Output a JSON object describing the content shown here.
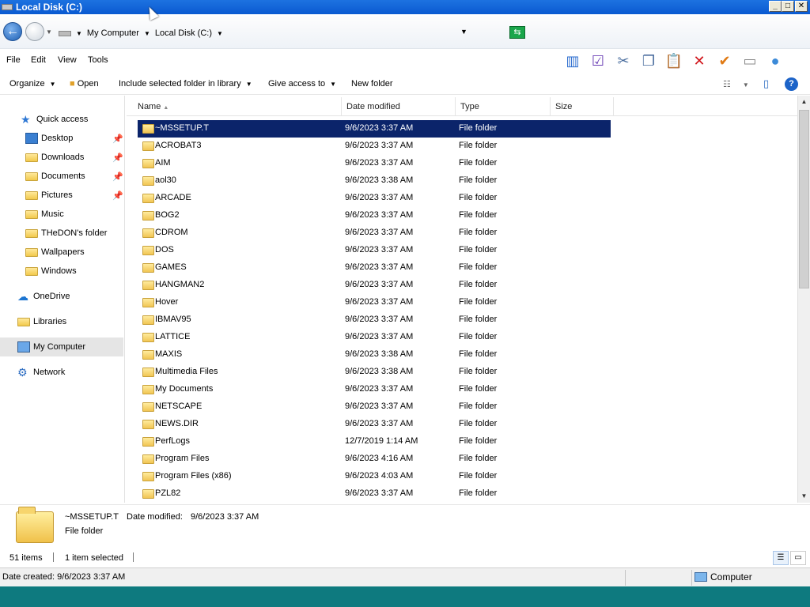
{
  "window": {
    "title": "Local Disk (C:)"
  },
  "address": {
    "crumbs": [
      "My Computer",
      "Local Disk (C:)"
    ]
  },
  "menu": {
    "items": [
      "File",
      "Edit",
      "View",
      "Tools"
    ]
  },
  "commands": {
    "organize": "Organize",
    "open": "Open",
    "include": "Include selected folder in library",
    "share": "Give access to",
    "new_folder": "New folder",
    "help": "?"
  },
  "nav": {
    "quick_access": "Quick access",
    "items": [
      {
        "label": "Desktop",
        "pinned": true
      },
      {
        "label": "Downloads",
        "pinned": true
      },
      {
        "label": "Documents",
        "pinned": true
      },
      {
        "label": "Pictures",
        "pinned": true
      },
      {
        "label": "Music",
        "pinned": false
      },
      {
        "label": "THeDON's folder",
        "pinned": false
      },
      {
        "label": "Wallpapers",
        "pinned": false
      },
      {
        "label": "Windows",
        "pinned": false
      }
    ],
    "onedrive": "OneDrive",
    "libraries": "Libraries",
    "my_computer": "My Computer",
    "network": "Network"
  },
  "columns": {
    "name": "Name",
    "date": "Date modified",
    "type": "Type",
    "size": "Size"
  },
  "files": [
    {
      "name": "~MSSETUP.T",
      "date": "9/6/2023 3:37 AM",
      "type": "File folder",
      "selected": true
    },
    {
      "name": "ACROBAT3",
      "date": "9/6/2023 3:37 AM",
      "type": "File folder"
    },
    {
      "name": "AIM",
      "date": "9/6/2023 3:37 AM",
      "type": "File folder"
    },
    {
      "name": "aol30",
      "date": "9/6/2023 3:38 AM",
      "type": "File folder"
    },
    {
      "name": "ARCADE",
      "date": "9/6/2023 3:37 AM",
      "type": "File folder"
    },
    {
      "name": "BOG2",
      "date": "9/6/2023 3:37 AM",
      "type": "File folder"
    },
    {
      "name": "CDROM",
      "date": "9/6/2023 3:37 AM",
      "type": "File folder"
    },
    {
      "name": "DOS",
      "date": "9/6/2023 3:37 AM",
      "type": "File folder"
    },
    {
      "name": "GAMES",
      "date": "9/6/2023 3:37 AM",
      "type": "File folder"
    },
    {
      "name": "HANGMAN2",
      "date": "9/6/2023 3:37 AM",
      "type": "File folder"
    },
    {
      "name": "Hover",
      "date": "9/6/2023 3:37 AM",
      "type": "File folder"
    },
    {
      "name": "IBMAV95",
      "date": "9/6/2023 3:37 AM",
      "type": "File folder"
    },
    {
      "name": "LATTICE",
      "date": "9/6/2023 3:37 AM",
      "type": "File folder"
    },
    {
      "name": "MAXIS",
      "date": "9/6/2023 3:38 AM",
      "type": "File folder"
    },
    {
      "name": "Multimedia Files",
      "date": "9/6/2023 3:38 AM",
      "type": "File folder"
    },
    {
      "name": "My Documents",
      "date": "9/6/2023 3:37 AM",
      "type": "File folder"
    },
    {
      "name": "NETSCAPE",
      "date": "9/6/2023 3:37 AM",
      "type": "File folder"
    },
    {
      "name": "NEWS.DIR",
      "date": "9/6/2023 3:37 AM",
      "type": "File folder"
    },
    {
      "name": "PerfLogs",
      "date": "12/7/2019 1:14 AM",
      "type": "File folder"
    },
    {
      "name": "Program Files",
      "date": "9/6/2023 4:16 AM",
      "type": "File folder"
    },
    {
      "name": "Program Files (x86)",
      "date": "9/6/2023 4:03 AM",
      "type": "File folder"
    },
    {
      "name": "PZL82",
      "date": "9/6/2023 3:37 AM",
      "type": "File folder"
    }
  ],
  "details": {
    "name": "~MSSETUP.T",
    "date_label": "Date modified:",
    "date_value": "9/6/2023 3:37 AM",
    "type": "File folder"
  },
  "counts": {
    "items": "51 items",
    "selected": "1 item selected"
  },
  "status": {
    "text": "Date created: 9/6/2023 3:37 AM",
    "zone": "Computer"
  },
  "colors": {
    "selection": "#0b246a",
    "titlebar": "#0a5ad1",
    "desktop": "#0e7a7f"
  }
}
